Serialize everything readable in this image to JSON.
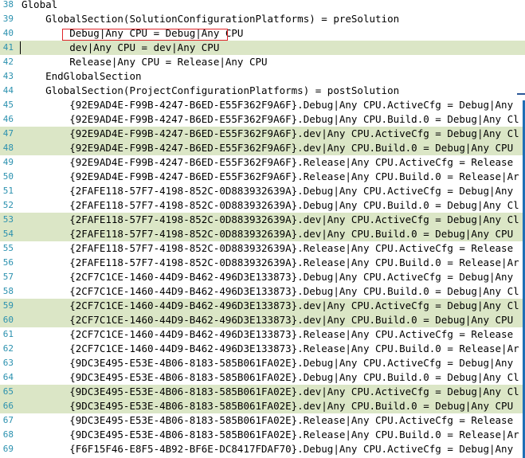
{
  "editor": {
    "lines": [
      {
        "num": "38",
        "text": "Global",
        "highlight": false,
        "caret": false
      },
      {
        "num": "39",
        "text": "    GlobalSection(SolutionConfigurationPlatforms) = preSolution",
        "highlight": false,
        "caret": false
      },
      {
        "num": "40",
        "text": "        Debug|Any CPU = Debug|Any CPU",
        "highlight": false,
        "caret": false
      },
      {
        "num": "41",
        "text": "        dev|Any CPU = dev|Any CPU",
        "highlight": true,
        "caret": true
      },
      {
        "num": "42",
        "text": "        Release|Any CPU = Release|Any CPU",
        "highlight": false,
        "caret": false
      },
      {
        "num": "43",
        "text": "    EndGlobalSection",
        "highlight": false,
        "caret": false
      },
      {
        "num": "44",
        "text": "    GlobalSection(ProjectConfigurationPlatforms) = postSolution",
        "highlight": false,
        "caret": false
      },
      {
        "num": "45",
        "text": "        {92E9AD4E-F99B-4247-B6ED-E55F362F9A6F}.Debug|Any CPU.ActiveCfg = Debug|Any",
        "highlight": false,
        "caret": false
      },
      {
        "num": "46",
        "text": "        {92E9AD4E-F99B-4247-B6ED-E55F362F9A6F}.Debug|Any CPU.Build.0 = Debug|Any Cl",
        "highlight": false,
        "caret": false
      },
      {
        "num": "47",
        "text": "        {92E9AD4E-F99B-4247-B6ED-E55F362F9A6F}.dev|Any CPU.ActiveCfg = Debug|Any Cl",
        "highlight": true,
        "caret": false
      },
      {
        "num": "48",
        "text": "        {92E9AD4E-F99B-4247-B6ED-E55F362F9A6F}.dev|Any CPU.Build.0 = Debug|Any CPU",
        "highlight": true,
        "caret": false
      },
      {
        "num": "49",
        "text": "        {92E9AD4E-F99B-4247-B6ED-E55F362F9A6F}.Release|Any CPU.ActiveCfg = Release",
        "highlight": false,
        "caret": false
      },
      {
        "num": "50",
        "text": "        {92E9AD4E-F99B-4247-B6ED-E55F362F9A6F}.Release|Any CPU.Build.0 = Release|Ar",
        "highlight": false,
        "caret": false
      },
      {
        "num": "51",
        "text": "        {2FAFE118-57F7-4198-852C-0D883932639A}.Debug|Any CPU.ActiveCfg = Debug|Any",
        "highlight": false,
        "caret": false
      },
      {
        "num": "52",
        "text": "        {2FAFE118-57F7-4198-852C-0D883932639A}.Debug|Any CPU.Build.0 = Debug|Any Cl",
        "highlight": false,
        "caret": false
      },
      {
        "num": "53",
        "text": "        {2FAFE118-57F7-4198-852C-0D883932639A}.dev|Any CPU.ActiveCfg = Debug|Any Cl",
        "highlight": true,
        "caret": false
      },
      {
        "num": "54",
        "text": "        {2FAFE118-57F7-4198-852C-0D883932639A}.dev|Any CPU.Build.0 = Debug|Any CPU",
        "highlight": true,
        "caret": false
      },
      {
        "num": "55",
        "text": "        {2FAFE118-57F7-4198-852C-0D883932639A}.Release|Any CPU.ActiveCfg = Release",
        "highlight": false,
        "caret": false
      },
      {
        "num": "56",
        "text": "        {2FAFE118-57F7-4198-852C-0D883932639A}.Release|Any CPU.Build.0 = Release|Ar",
        "highlight": false,
        "caret": false
      },
      {
        "num": "57",
        "text": "        {2CF7C1CE-1460-44D9-B462-496D3E133873}.Debug|Any CPU.ActiveCfg = Debug|Any",
        "highlight": false,
        "caret": false
      },
      {
        "num": "58",
        "text": "        {2CF7C1CE-1460-44D9-B462-496D3E133873}.Debug|Any CPU.Build.0 = Debug|Any Cl",
        "highlight": false,
        "caret": false
      },
      {
        "num": "59",
        "text": "        {2CF7C1CE-1460-44D9-B462-496D3E133873}.dev|Any CPU.ActiveCfg = Debug|Any Cl",
        "highlight": true,
        "caret": false
      },
      {
        "num": "60",
        "text": "        {2CF7C1CE-1460-44D9-B462-496D3E133873}.dev|Any CPU.Build.0 = Debug|Any CPU",
        "highlight": true,
        "caret": false
      },
      {
        "num": "61",
        "text": "        {2CF7C1CE-1460-44D9-B462-496D3E133873}.Release|Any CPU.ActiveCfg = Release",
        "highlight": false,
        "caret": false
      },
      {
        "num": "62",
        "text": "        {2CF7C1CE-1460-44D9-B462-496D3E133873}.Release|Any CPU.Build.0 = Release|Ar",
        "highlight": false,
        "caret": false
      },
      {
        "num": "63",
        "text": "        {9DC3E495-E53E-4B06-8183-585B061FA02E}.Debug|Any CPU.ActiveCfg = Debug|Any",
        "highlight": false,
        "caret": false
      },
      {
        "num": "64",
        "text": "        {9DC3E495-E53E-4B06-8183-585B061FA02E}.Debug|Any CPU.Build.0 = Debug|Any Cl",
        "highlight": false,
        "caret": false
      },
      {
        "num": "65",
        "text": "        {9DC3E495-E53E-4B06-8183-585B061FA02E}.dev|Any CPU.ActiveCfg = Debug|Any Cl",
        "highlight": true,
        "caret": false
      },
      {
        "num": "66",
        "text": "        {9DC3E495-E53E-4B06-8183-585B061FA02E}.dev|Any CPU.Build.0 = Debug|Any CPU",
        "highlight": true,
        "caret": false
      },
      {
        "num": "67",
        "text": "        {9DC3E495-E53E-4B06-8183-585B061FA02E}.Release|Any CPU.ActiveCfg = Release",
        "highlight": false,
        "caret": false
      },
      {
        "num": "68",
        "text": "        {9DC3E495-E53E-4B06-8183-585B061FA02E}.Release|Any CPU.Build.0 = Release|Ar",
        "highlight": false,
        "caret": false
      },
      {
        "num": "69",
        "text": "        {F6F15F46-E8F5-4B92-BF6E-DC8417FDAF70}.Debug|Any CPU.ActiveCfg = Debug|Any",
        "highlight": false,
        "caret": false
      }
    ]
  },
  "colors": {
    "line_number": "#2b91af",
    "highlight_bg": "#dbe6c6",
    "annotation_box": "#e0262b",
    "scrollbar": "#1f6fb5"
  }
}
